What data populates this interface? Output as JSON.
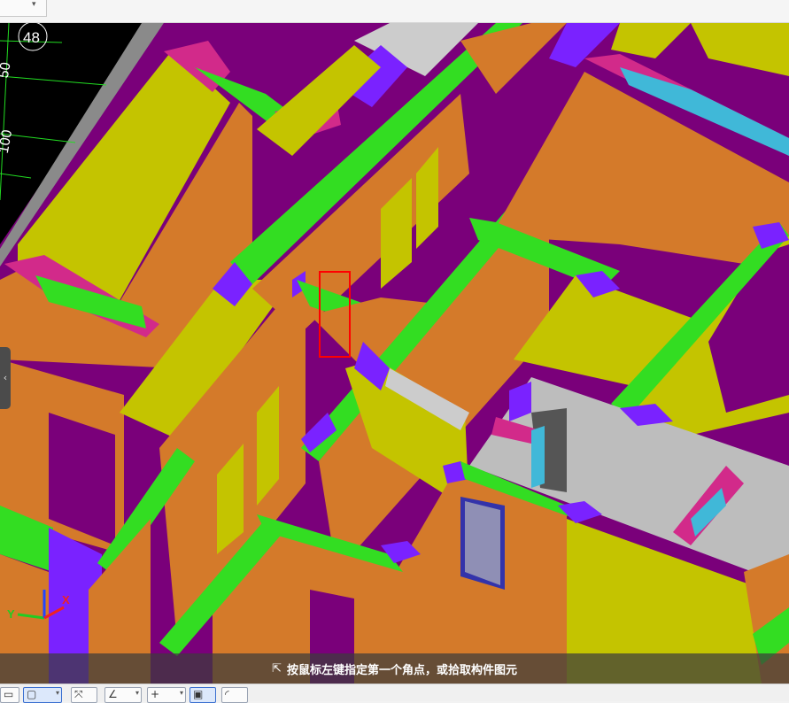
{
  "status_bar": {
    "hint": "按鼠标左键指定第一个角点，或拾取构件图元",
    "icon": "corner-pick-icon"
  },
  "cad_overlay": {
    "axis_number": "48",
    "dim_label_1": "50",
    "dim_label_2": "100"
  },
  "axes": {
    "x_label": "X",
    "y_label": "Y"
  },
  "side_tab": {
    "glyph": "‹"
  },
  "colors": {
    "wall": "#d47a2a",
    "wall_face": "#c4c400",
    "floor": "#7a007a",
    "beam": "#33dd22",
    "column": "#7a22ff",
    "slab": "#cccccc",
    "beam_special": "#d22a8a",
    "beam_blue": "#40b8d8",
    "highlight": "#ff0000"
  },
  "toolbar": {
    "icons": [
      "select-rect-icon",
      "select-dropdown-icon",
      "cross-select-icon",
      "angle-icon",
      "plus-snap-icon",
      "display-icon",
      "arc-icon"
    ]
  }
}
